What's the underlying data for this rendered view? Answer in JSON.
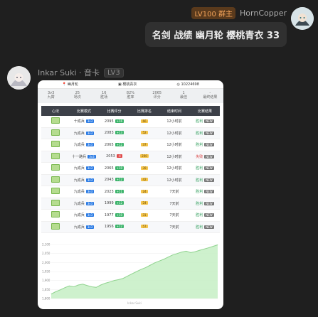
{
  "top_message": {
    "level_badge": "LV100 群主",
    "username": "HornCopper",
    "text": "名剑 战绩 幽月轮 樱桃青衣 33"
  },
  "reply": {
    "username": "Inkar Suki · 音卡",
    "level_badge": "LV3",
    "card": {
      "info": {
        "server": "幽月轮",
        "role": "樱桃青衣",
        "id": "10224698"
      },
      "stats": [
        {
          "value": "3v3",
          "label": "九霄"
        },
        {
          "value": "25",
          "label": "场次"
        },
        {
          "value": "16",
          "label": "胜场"
        },
        {
          "value": "82%",
          "label": "胜率"
        },
        {
          "value": "2065",
          "label": "评分"
        },
        {
          "value": "1",
          "label": "最佳"
        },
        {
          "value": "-",
          "label": "最终结果"
        }
      ],
      "columns": [
        "心法",
        "比赛模式",
        "比赛评分",
        "比赛排名",
        "结束时间",
        "比赛结果"
      ],
      "rows": [
        {
          "mode": "十成兵",
          "tag": "3v3",
          "score": "2095",
          "delta": "+16",
          "delta_color": "#3bb36a",
          "rank": "66",
          "time": "12小时前",
          "result": "胜利",
          "result_color": "#2e9d5a",
          "new": "NEW"
        },
        {
          "mode": "九成兵",
          "tag": "3v3",
          "score": "2083",
          "delta": "+13",
          "delta_color": "#3bb36a",
          "rank": "52",
          "time": "12小时前",
          "result": "胜利",
          "result_color": "#2e9d5a",
          "new": "NEW"
        },
        {
          "mode": "九成兵",
          "tag": "3v3",
          "score": "2065",
          "delta": "+12",
          "delta_color": "#3bb36a",
          "rank": "37",
          "time": "12小时前",
          "result": "胜利",
          "result_color": "#2e9d5a",
          "new": "NEW"
        },
        {
          "mode": "十一路兵",
          "tag": "3v3",
          "score": "2053",
          "delta": "-4",
          "delta_color": "#e04a4a",
          "rank": "200",
          "time": "12小时前",
          "result": "失败",
          "result_color": "#d83a3a",
          "new": "NEW"
        },
        {
          "mode": "九成兵",
          "tag": "3v3",
          "score": "2065",
          "delta": "+10",
          "delta_color": "#3bb36a",
          "rank": "39",
          "time": "12小时前",
          "result": "胜利",
          "result_color": "#2e9d5a",
          "new": "NEW"
        },
        {
          "mode": "九成兵",
          "tag": "3v3",
          "score": "2043",
          "delta": "+12",
          "delta_color": "#3bb36a",
          "rank": "42",
          "time": "12小时前",
          "result": "胜利",
          "result_color": "#2e9d5a",
          "new": "NEW"
        },
        {
          "mode": "九成兵",
          "tag": "3v3",
          "score": "2023",
          "delta": "+11",
          "delta_color": "#3bb36a",
          "rank": "24",
          "time": "7天前",
          "result": "胜利",
          "result_color": "#2e9d5a",
          "new": "NEW"
        },
        {
          "mode": "九成兵",
          "tag": "3v3",
          "score": "1999",
          "delta": "+12",
          "delta_color": "#3bb36a",
          "rank": "24",
          "time": "7天前",
          "result": "胜利",
          "result_color": "#2e9d5a",
          "new": "NEW"
        },
        {
          "mode": "九成兵",
          "tag": "3v3",
          "score": "1977",
          "delta": "+10",
          "delta_color": "#3bb36a",
          "rank": "31",
          "time": "7天前",
          "result": "胜利",
          "result_color": "#2e9d5a",
          "new": "NEW"
        },
        {
          "mode": "九成兵",
          "tag": "3v3",
          "score": "1956",
          "delta": "+12",
          "delta_color": "#3bb36a",
          "rank": "57",
          "time": "7天前",
          "result": "胜利",
          "result_color": "#2e9d5a",
          "new": "NEW"
        }
      ]
    }
  },
  "chart_data": {
    "type": "area",
    "title": "",
    "xlabel": "Inkar-Suki",
    "ylabel": "",
    "ylim": [
      1800,
      2100
    ],
    "yticks": [
      "2,100",
      "2,050",
      "2,000",
      "1,950",
      "1,900",
      "1,850",
      "1,800"
    ],
    "series": [
      {
        "values": [
          1825,
          1838,
          1848,
          1860,
          1870,
          1865,
          1875,
          1880,
          1872,
          1865,
          1862,
          1875,
          1885,
          1892,
          1900,
          1905,
          1912,
          1925,
          1938,
          1950,
          1962,
          1972,
          1985,
          1998,
          2008,
          2018,
          2030,
          2042,
          2050,
          2058,
          2063,
          2055,
          2060,
          2068,
          2075,
          2082,
          2090,
          2098
        ]
      }
    ],
    "line_color": "#8fd38e",
    "fill_color": "#c6efc4"
  }
}
